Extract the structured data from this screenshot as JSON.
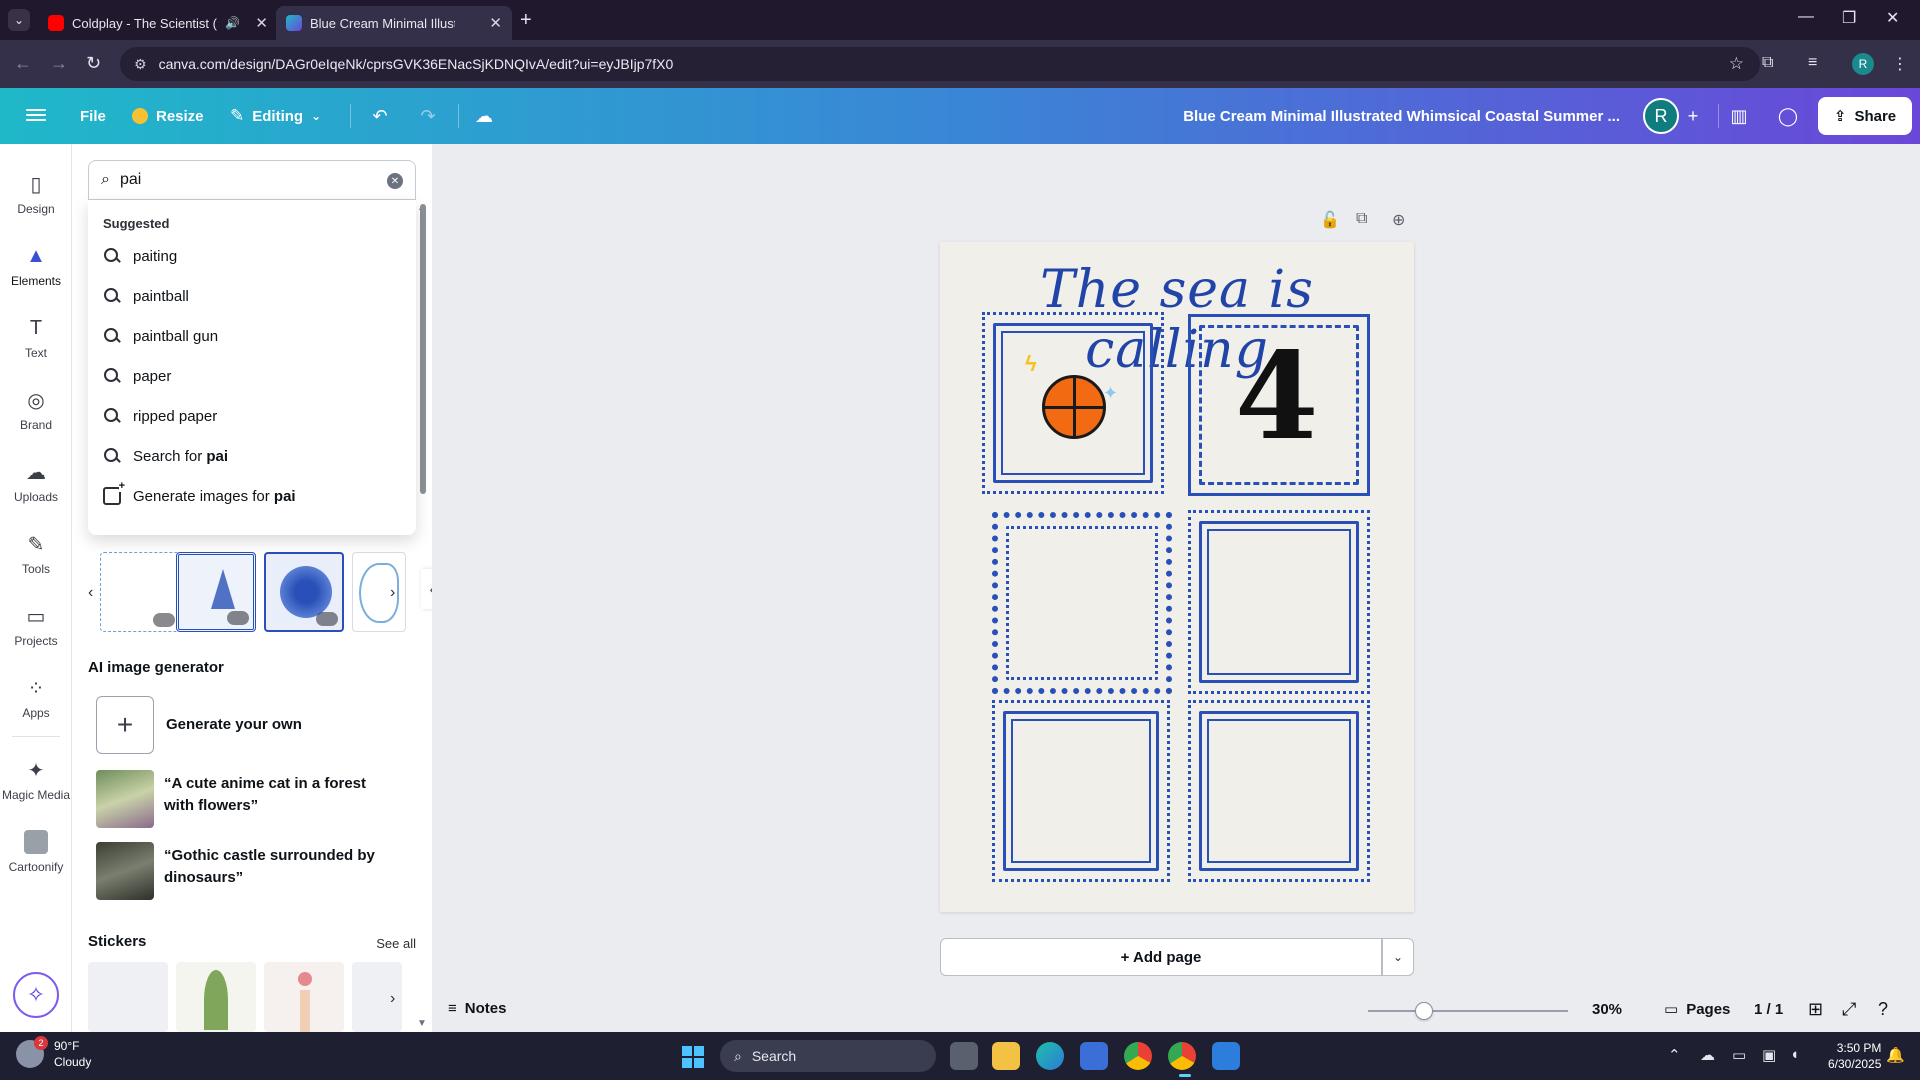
{
  "browser": {
    "tabs": [
      {
        "title": "Coldplay - The Scientist (Of",
        "active": false
      },
      {
        "title": "Blue Cream Minimal Illustrated",
        "active": true
      }
    ],
    "url": "canva.com/design/DAGr0eIqeNk/cprsGVK36ENacSjKDNQIvA/edit?ui=eyJBIjp7fX0",
    "profile_initial": "R"
  },
  "header": {
    "file": "File",
    "resize": "Resize",
    "editing": "Editing",
    "title": "Blue Cream Minimal Illustrated Whimsical Coastal Summer ...",
    "avatar_initial": "R",
    "share": "Share"
  },
  "rail": {
    "items": [
      {
        "label": "Design",
        "icon": "layout-icon"
      },
      {
        "label": "Elements",
        "icon": "shapes-icon"
      },
      {
        "label": "Text",
        "icon": "text-icon"
      },
      {
        "label": "Brand",
        "icon": "brand-icon"
      },
      {
        "label": "Uploads",
        "icon": "cloud-upload-icon"
      },
      {
        "label": "Tools",
        "icon": "pen-icon"
      },
      {
        "label": "Projects",
        "icon": "folder-icon"
      },
      {
        "label": "Apps",
        "icon": "apps-icon"
      },
      {
        "label": "Magic Media",
        "icon": "magic-media-icon"
      },
      {
        "label": "Cartoonify",
        "icon": "cartoonify-icon"
      }
    ]
  },
  "panel": {
    "search_value": "pai",
    "suggested_header": "Suggested",
    "suggestions": [
      "paiting",
      "paintball",
      "paintball gun",
      "paper",
      "ripped paper"
    ],
    "search_for_prefix": "Search for",
    "generate_prefix": "Generate images for",
    "query_bold": "pai",
    "ai_section": "AI image generator",
    "generate_own": "Generate your own",
    "ai_examples": [
      "“A cute anime cat in a forest with flowers”",
      "“Gothic castle surrounded by dinosaurs”"
    ],
    "stickers_section": "Stickers",
    "see_all": "See all"
  },
  "canvas": {
    "page_title": "The sea is calling",
    "add_page": "+ Add page"
  },
  "footer": {
    "notes": "Notes",
    "zoom": "30%",
    "zoom_level": 0.3,
    "pages": "Pages",
    "page_count": "1 / 1"
  },
  "taskbar": {
    "temp": "90°F",
    "condition": "Cloudy",
    "weather_badge": "2",
    "search": "Search",
    "time": "3:50 PM",
    "date": "6/30/2025"
  },
  "colors": {
    "accent": "#3a4fd8",
    "frame_blue": "#2950b8",
    "page_bg": "#f1efe9",
    "header_gradient_start": "#1fb8c9",
    "header_gradient_end": "#6a47d8"
  }
}
